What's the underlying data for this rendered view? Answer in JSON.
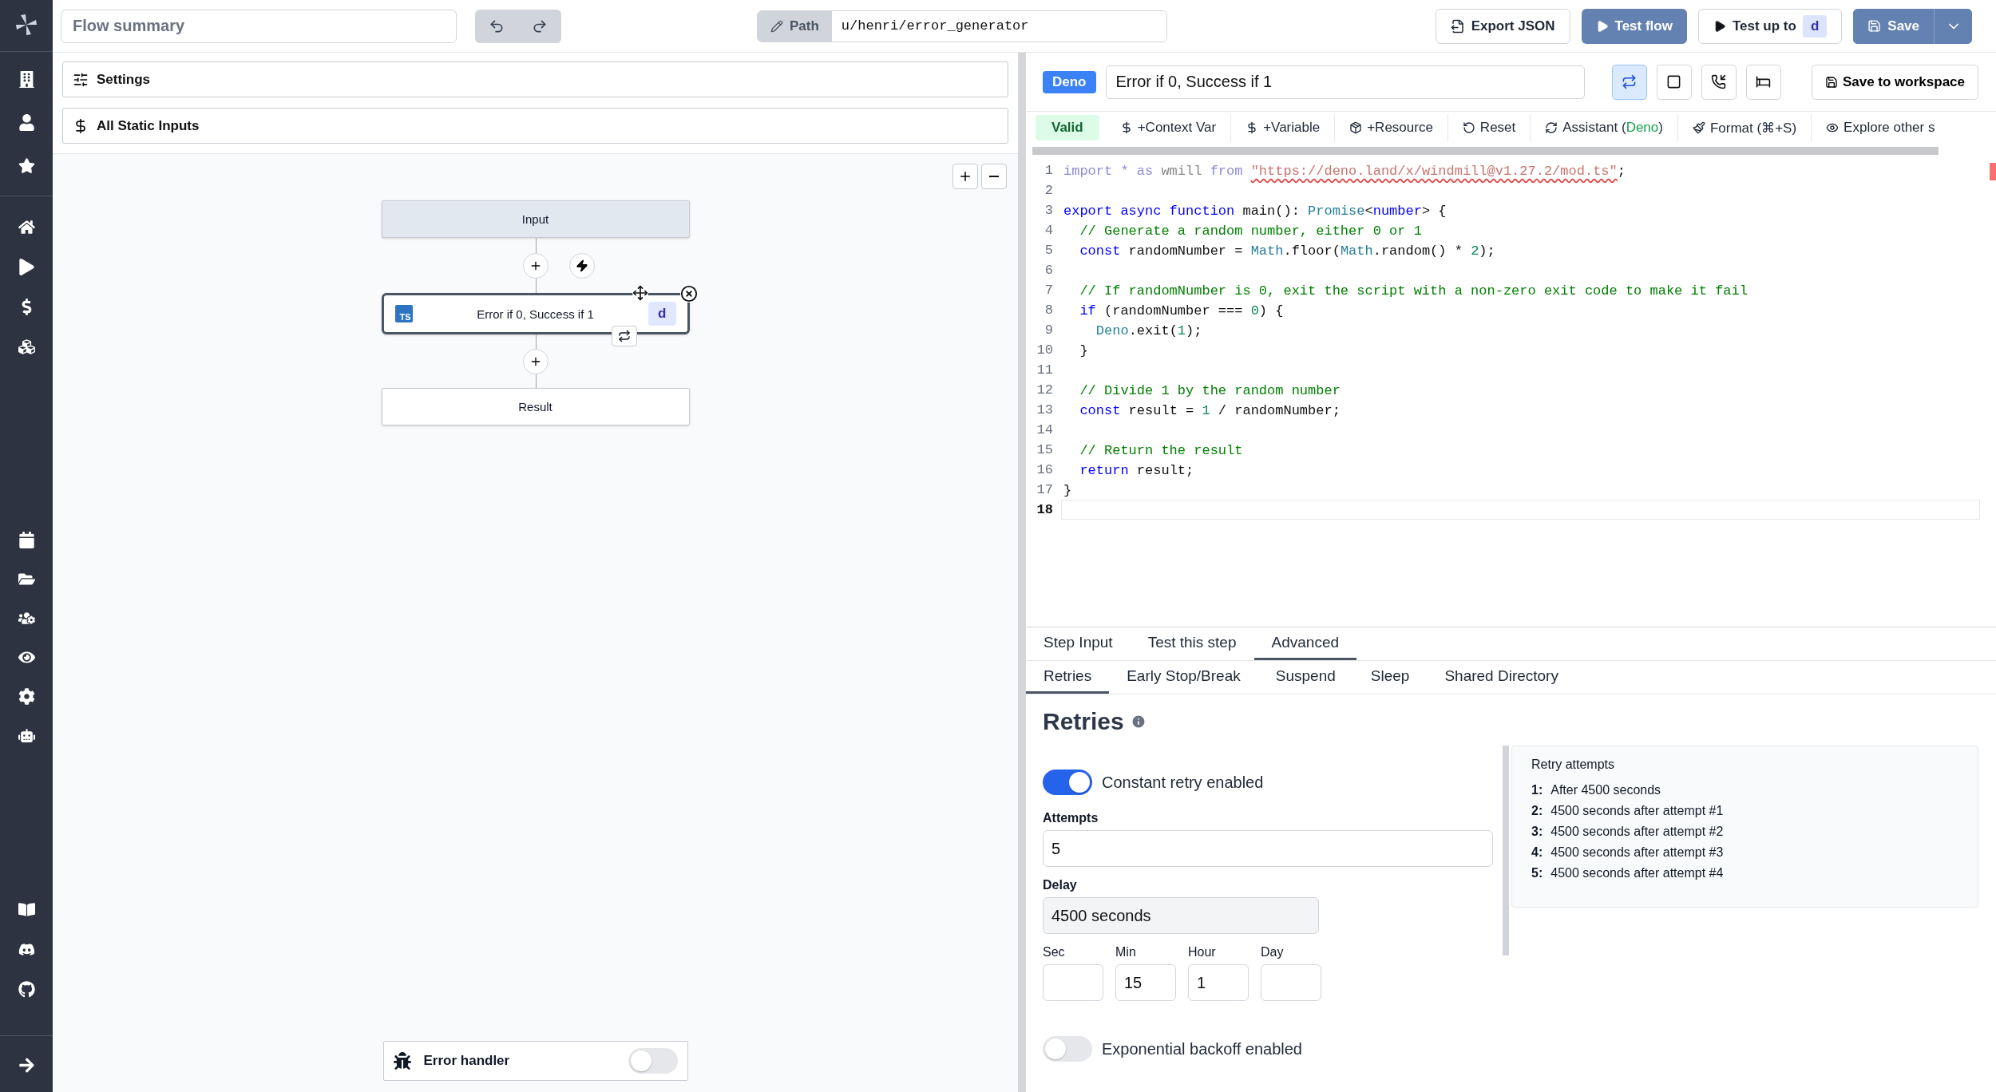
{
  "top_bar": {
    "summary": {
      "placeholder": "Flow summary"
    },
    "path": {
      "label": "Path",
      "value": "u/henri/error_generator"
    },
    "buttons": [
      {
        "kind": "export",
        "label": "Export JSON"
      },
      {
        "kind": "test",
        "label": "Test flow"
      },
      {
        "kind": "test_up_to",
        "label": "Test up to",
        "badge": "d"
      },
      {
        "kind": "save",
        "label": "Save"
      }
    ]
  },
  "left_panel": {
    "sections": [
      {
        "kind": "settings",
        "label": "Settings"
      },
      {
        "kind": "static_inputs",
        "label": "All Static Inputs"
      }
    ]
  },
  "flow": {
    "nodes": [
      {
        "kind": "input",
        "label": "Input",
        "selected": false
      },
      {
        "kind": "step",
        "label": "Error if 0, Success if 1",
        "language": "TS",
        "badge": "d",
        "selected": true
      },
      {
        "kind": "result",
        "label": "Result",
        "selected": false
      }
    ],
    "error_handler": {
      "label": "Error handler",
      "on": false
    }
  },
  "step_editor": {
    "language": "Deno",
    "summary": "Error if 0, Success if 1",
    "mode_buttons": [
      {
        "kind": "retry",
        "selected": true
      },
      {
        "kind": "stop",
        "selected": false
      },
      {
        "kind": "suspend",
        "selected": false
      },
      {
        "kind": "sleep",
        "selected": false
      }
    ],
    "save_button": "Save to workspace",
    "toolbar": [
      {
        "kind": "status",
        "label": "Valid"
      },
      {
        "kind": "context_var",
        "label": "+Context Var"
      },
      {
        "kind": "variable",
        "label": "+Variable"
      },
      {
        "kind": "resource",
        "label": "+Resource"
      },
      {
        "kind": "reset",
        "label": "Reset"
      },
      {
        "kind": "assistant",
        "label": "Assistant (",
        "highlight": "Deno",
        "suffix": ")"
      },
      {
        "kind": "format",
        "label": "Format (⌘+S)"
      },
      {
        "kind": "explore",
        "label": "Explore other s"
      }
    ],
    "code": [
      {
        "number": "1",
        "current": false,
        "tokens": [
          {
            "kind": "faded",
            "text": "import * as"
          },
          {
            "kind": "dim",
            "text": " wmill "
          },
          {
            "kind": "faded",
            "text": "from "
          },
          {
            "kind": "string_error",
            "text": "\"https://deno.land/x/windmill@v1.27.2/mod.ts\""
          },
          {
            "kind": "plain",
            "text": ";"
          }
        ]
      },
      {
        "number": "2",
        "current": false
      },
      {
        "number": "3",
        "current": false,
        "tokens": [
          {
            "kind": "keyword",
            "text": "export async function"
          },
          {
            "kind": "plain",
            "text": " main(): "
          },
          {
            "kind": "type",
            "text": "Promise"
          },
          {
            "kind": "plain",
            "text": "<"
          },
          {
            "kind": "keyword",
            "text": "number"
          },
          {
            "kind": "plain",
            "text": "> {"
          }
        ]
      },
      {
        "number": "4",
        "current": false,
        "tokens": [
          {
            "kind": "comment",
            "text": "  // Generate a random number, either 0 or 1"
          }
        ]
      },
      {
        "number": "5",
        "current": false,
        "tokens": [
          {
            "kind": "keyword",
            "text": "  const"
          },
          {
            "kind": "plain",
            "text": " randomNumber = "
          },
          {
            "kind": "type",
            "text": "Math"
          },
          {
            "kind": "plain",
            "text": ".floor("
          },
          {
            "kind": "type",
            "text": "Math"
          },
          {
            "kind": "plain",
            "text": ".random() * "
          },
          {
            "kind": "number",
            "text": "2"
          },
          {
            "kind": "plain",
            "text": ");"
          }
        ]
      },
      {
        "number": "6",
        "current": false
      },
      {
        "number": "7",
        "current": false,
        "tokens": [
          {
            "kind": "comment",
            "text": "  // If randomNumber is 0, exit the script with a non-zero exit code to make it fail"
          }
        ]
      },
      {
        "number": "8",
        "current": false,
        "tokens": [
          {
            "kind": "keyword",
            "text": "  if"
          },
          {
            "kind": "plain",
            "text": " (randomNumber === "
          },
          {
            "kind": "number",
            "text": "0"
          },
          {
            "kind": "plain",
            "text": ") {"
          }
        ]
      },
      {
        "number": "9",
        "current": false,
        "tokens": [
          {
            "kind": "type",
            "text": "    Deno"
          },
          {
            "kind": "plain",
            "text": ".exit("
          },
          {
            "kind": "number",
            "text": "1"
          },
          {
            "kind": "plain",
            "text": ");"
          }
        ]
      },
      {
        "number": "10",
        "current": false,
        "tokens": [
          {
            "kind": "plain",
            "text": "  }"
          }
        ]
      },
      {
        "number": "11",
        "current": false
      },
      {
        "number": "12",
        "current": false,
        "tokens": [
          {
            "kind": "comment",
            "text": "  // Divide 1 by the random number"
          }
        ]
      },
      {
        "number": "13",
        "current": false,
        "tokens": [
          {
            "kind": "keyword",
            "text": "  const"
          },
          {
            "kind": "plain",
            "text": " result = "
          },
          {
            "kind": "number",
            "text": "1"
          },
          {
            "kind": "plain",
            "text": " / randomNumber;"
          }
        ]
      },
      {
        "number": "14",
        "current": false
      },
      {
        "number": "15",
        "current": false,
        "tokens": [
          {
            "kind": "comment",
            "text": "  // Return the result"
          }
        ]
      },
      {
        "number": "16",
        "current": false,
        "tokens": [
          {
            "kind": "keyword",
            "text": "  return"
          },
          {
            "kind": "plain",
            "text": " result;"
          }
        ]
      },
      {
        "number": "17",
        "current": false,
        "tokens": [
          {
            "kind": "plain",
            "text": "}"
          }
        ]
      },
      {
        "number": "18",
        "current": true
      }
    ],
    "tabs": [
      {
        "label": "Step Input",
        "selected": false
      },
      {
        "label": "Test this step",
        "selected": false
      },
      {
        "label": "Advanced",
        "selected": true
      }
    ],
    "subtabs": [
      {
        "label": "Retries",
        "selected": true
      },
      {
        "label": "Early Stop/Break",
        "selected": false
      },
      {
        "label": "Suspend",
        "selected": false
      },
      {
        "label": "Sleep",
        "selected": false
      },
      {
        "label": "Shared Directory",
        "selected": false
      }
    ],
    "retries": {
      "title": "Retries",
      "constant": {
        "label": "Constant retry enabled",
        "on": true,
        "attempts_label": "Attempts",
        "attempts": "5",
        "delay_label": "Delay",
        "delay": "4500 seconds",
        "units": [
          {
            "label": "Sec"
          },
          {
            "label": "Min",
            "value": "15"
          },
          {
            "label": "Hour",
            "value": "1"
          },
          {
            "label": "Day"
          }
        ]
      },
      "exponential": {
        "label": "Exponential backoff enabled",
        "on": false
      },
      "attempts_list": {
        "title": "Retry attempts",
        "items": [
          {
            "number": "1:",
            "text": "After 4500 seconds"
          },
          {
            "number": "2:",
            "text": "4500 seconds after attempt #1"
          },
          {
            "number": "3:",
            "text": "4500 seconds after attempt #2"
          },
          {
            "number": "4:",
            "text": "4500 seconds after attempt #3"
          },
          {
            "number": "5:",
            "text": "4500 seconds after attempt #4"
          }
        ]
      }
    }
  }
}
